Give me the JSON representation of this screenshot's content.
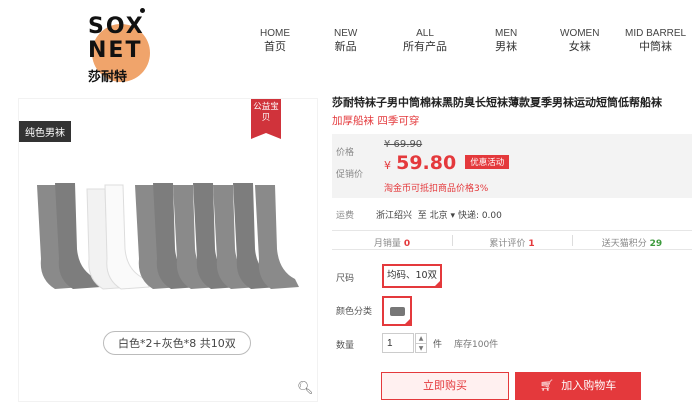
{
  "brand": {
    "logo_line1": "SOX",
    "logo_line2": "NET",
    "logo_cn": "莎耐特"
  },
  "nav": [
    {
      "en": "HOME",
      "cn": "首页"
    },
    {
      "en": "NEW",
      "cn": "新品"
    },
    {
      "en": "ALL",
      "cn": "所有产品"
    },
    {
      "en": "MEN",
      "cn": "男袜"
    },
    {
      "en": "WOMEN",
      "cn": "女袜"
    },
    {
      "en": "MID BARREL",
      "cn": "中筒袜"
    }
  ],
  "gallery": {
    "corner_tag": "纯色男袜",
    "badge": "公益宝贝",
    "caption": "白色*2+灰色*8  共10双",
    "zoom_icon": "magnifier-icon"
  },
  "product": {
    "title": "莎耐特袜子男中筒棉袜黑防臭长短袜薄款夏季男袜运动短筒低帮船袜",
    "subtitle": "加厚船袜  四季可穿"
  },
  "price": {
    "orig_label": "价格",
    "orig_value": "¥ 69.90",
    "promo_label": "促销价",
    "currency": "¥",
    "promo_value": "59.80",
    "promo_tag": "优惠活动",
    "coin_note": "淘金币可抵扣商品价格3%"
  },
  "shipping": {
    "label": "运费",
    "from": "浙江绍兴",
    "to_prefix": "至",
    "to": "北京",
    "fee": "快递: 0.00"
  },
  "stats": {
    "monthly_label": "月销量",
    "monthly_value": "0",
    "reviews_label": "累计评价",
    "reviews_value": "1",
    "points_label": "送天猫积分",
    "points_value": "29"
  },
  "options": {
    "size_label": "尺码",
    "size_value": "均码、10双",
    "color_label": "颜色分类",
    "qty_label": "数量",
    "qty_value": "1",
    "qty_unit": "件",
    "stock": "库存100件"
  },
  "actions": {
    "buy_now": "立即购买",
    "add_to_cart": "加入购物车",
    "cart_icon": "cart-icon"
  },
  "colors": {
    "accent": "#e4393c",
    "logo_circle": "#f0a46b"
  }
}
